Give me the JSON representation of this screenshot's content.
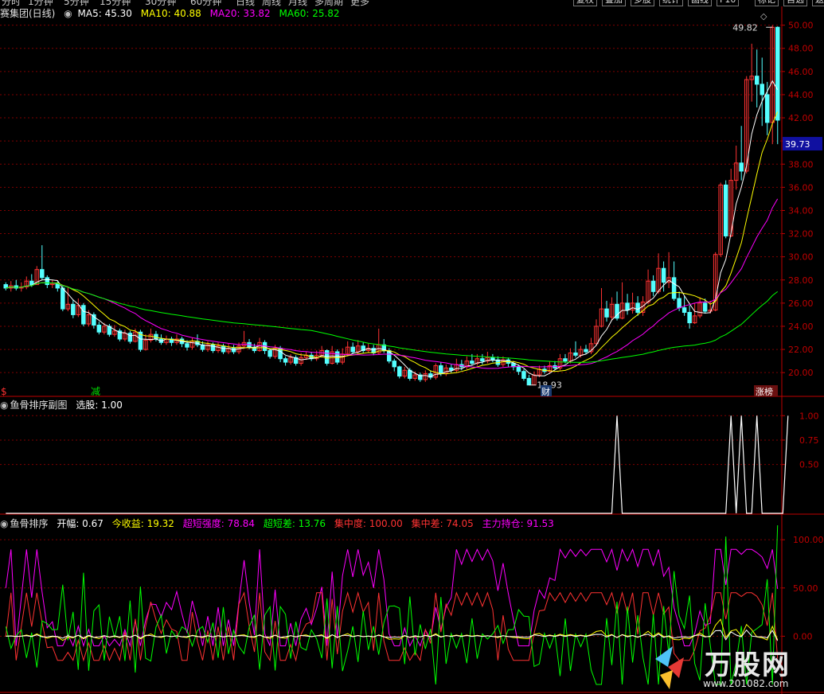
{
  "top_menu": {
    "left_items": [
      "分时",
      "1分钟",
      "5分钟",
      "15分钟",
      "30分钟",
      "60分钟",
      "日线",
      "周线",
      "月线",
      "多周期",
      "更多"
    ],
    "right_buttons": [
      "复权",
      "叠加",
      "多股",
      "统计",
      "画线",
      "F10",
      "标记",
      "自选",
      "返回"
    ]
  },
  "main_header": {
    "stock_name": "赛集团(日线)",
    "ma5": "MA5: 45.30",
    "ma10": "MA10: 40.88",
    "ma20": "MA20: 33.82",
    "ma60": "MA60: 25.82"
  },
  "sub1_header": {
    "title": "鱼骨排序副图",
    "value": "选股: 1.00"
  },
  "sub2_header": {
    "title": "鱼骨排序",
    "items": [
      "开幅: 0.67",
      "今收益: 19.32",
      "超短强度: 78.84",
      "超短差: 13.76",
      "集中度: 100.00",
      "集中差: 74.05",
      "主力持仓: 91.53"
    ]
  },
  "markers": {
    "left": "$",
    "reduce": "减",
    "fin": "财",
    "rank": "涨榜",
    "low": "18.93",
    "high": "49.82",
    "current": "39.73"
  },
  "watermark": {
    "big": "万股网",
    "url": "www.201082.com"
  },
  "colors": {
    "up": "#ff3232",
    "down": "#54ffff",
    "ma5": "#ffffff",
    "ma10": "#ffff00",
    "ma20": "#ff00ff",
    "ma60": "#00ff00",
    "grid": "#800000",
    "axis": "#c00000"
  },
  "chart_data": [
    {
      "type": "candlestick",
      "title": "赛集团(日线)",
      "y_ticks": [
        20.0,
        22.0,
        24.0,
        26.0,
        28.0,
        30.0,
        32.0,
        34.0,
        36.0,
        38.0,
        40.0,
        42.0,
        44.0,
        46.0,
        48.0,
        50.0
      ],
      "ylim": [
        18.5,
        50.8
      ],
      "ma_legend": [
        "MA5",
        "MA10",
        "MA20",
        "MA60"
      ],
      "candles": [
        [
          27.6,
          27.3,
          27.8,
          27.1
        ],
        [
          27.3,
          27.5,
          27.9,
          27.0
        ],
        [
          27.5,
          27.3,
          28.0,
          27.1
        ],
        [
          27.3,
          27.4,
          27.8,
          27.0
        ],
        [
          27.4,
          27.9,
          28.3,
          27.2
        ],
        [
          27.9,
          27.6,
          28.5,
          27.4
        ],
        [
          27.6,
          28.9,
          29.2,
          27.6
        ],
        [
          28.9,
          28.2,
          31.0,
          28.0
        ],
        [
          28.2,
          27.6,
          28.4,
          27.3
        ],
        [
          27.6,
          27.7,
          28.0,
          27.3
        ],
        [
          27.7,
          27.3,
          27.9,
          27.0
        ],
        [
          27.3,
          25.5,
          27.5,
          25.3
        ],
        [
          25.5,
          25.9,
          27.4,
          25.3
        ],
        [
          25.9,
          25.0,
          26.3,
          24.7
        ],
        [
          25.0,
          25.8,
          26.4,
          24.8
        ],
        [
          25.8,
          24.2,
          26.0,
          24.0
        ],
        [
          24.2,
          25.0,
          25.4,
          24.0
        ],
        [
          25.0,
          24.1,
          25.2,
          23.8
        ],
        [
          24.1,
          23.5,
          24.4,
          23.3
        ],
        [
          23.5,
          24.0,
          24.3,
          23.3
        ],
        [
          24.0,
          23.3,
          24.2,
          23.1
        ],
        [
          23.3,
          23.6,
          24.1,
          23.1
        ],
        [
          23.6,
          22.9,
          23.8,
          22.7
        ],
        [
          22.9,
          23.4,
          23.7,
          22.7
        ],
        [
          23.4,
          22.7,
          23.6,
          22.5
        ],
        [
          22.7,
          23.5,
          23.8,
          22.6
        ],
        [
          23.5,
          22.0,
          23.7,
          21.8
        ],
        [
          22.0,
          22.8,
          23.3,
          21.9
        ],
        [
          22.8,
          23.3,
          23.8,
          22.6
        ],
        [
          23.3,
          22.9,
          23.6,
          22.7
        ],
        [
          22.9,
          22.6,
          23.3,
          22.4
        ],
        [
          22.6,
          22.9,
          23.2,
          22.4
        ],
        [
          22.9,
          22.6,
          23.1,
          22.3
        ],
        [
          22.6,
          22.9,
          23.3,
          22.4
        ],
        [
          22.9,
          22.5,
          23.1,
          22.2
        ],
        [
          22.5,
          22.2,
          22.8,
          21.9
        ],
        [
          22.2,
          22.7,
          23.0,
          22.0
        ],
        [
          22.7,
          22.4,
          23.3,
          22.2
        ],
        [
          22.4,
          22.0,
          22.7,
          21.8
        ],
        [
          22.0,
          22.4,
          22.7,
          21.8
        ],
        [
          22.4,
          21.9,
          22.6,
          21.7
        ],
        [
          21.9,
          22.3,
          22.6,
          21.7
        ],
        [
          22.3,
          21.8,
          22.5,
          21.6
        ],
        [
          21.8,
          22.1,
          22.5,
          21.6
        ],
        [
          22.1,
          21.8,
          22.4,
          21.6
        ],
        [
          21.8,
          22.3,
          22.6,
          21.6
        ],
        [
          22.3,
          22.6,
          23.6,
          22.1
        ],
        [
          22.6,
          22.2,
          22.9,
          22.0
        ],
        [
          22.2,
          21.9,
          22.5,
          21.7
        ],
        [
          21.9,
          22.6,
          23.0,
          21.8
        ],
        [
          22.6,
          21.9,
          22.8,
          21.6
        ],
        [
          21.9,
          21.4,
          22.1,
          21.2
        ],
        [
          21.4,
          22.1,
          22.4,
          21.2
        ],
        [
          22.1,
          21.2,
          22.3,
          20.9
        ],
        [
          21.2,
          20.9,
          21.4,
          20.6
        ],
        [
          20.9,
          21.3,
          21.6,
          20.7
        ],
        [
          21.3,
          20.8,
          21.5,
          20.6
        ],
        [
          20.8,
          21.3,
          21.7,
          20.6
        ],
        [
          21.3,
          21.5,
          21.8,
          21.1
        ],
        [
          21.5,
          21.2,
          21.8,
          21.0
        ],
        [
          21.2,
          21.5,
          21.9,
          21.0
        ],
        [
          21.5,
          21.9,
          22.3,
          21.3
        ],
        [
          21.9,
          20.8,
          22.0,
          20.6
        ],
        [
          20.8,
          21.8,
          22.3,
          20.7
        ],
        [
          21.8,
          20.9,
          22.0,
          20.7
        ],
        [
          20.9,
          21.6,
          22.1,
          20.7
        ],
        [
          21.6,
          22.2,
          22.7,
          21.4
        ],
        [
          22.2,
          21.8,
          22.6,
          21.6
        ],
        [
          21.8,
          22.3,
          22.8,
          21.6
        ],
        [
          22.3,
          21.9,
          22.6,
          21.7
        ],
        [
          21.9,
          22.1,
          22.5,
          21.7
        ],
        [
          22.1,
          21.7,
          22.4,
          21.5
        ],
        [
          21.7,
          22.4,
          23.8,
          21.6
        ],
        [
          22.4,
          21.9,
          22.9,
          21.7
        ],
        [
          21.9,
          21.0,
          22.1,
          20.8
        ],
        [
          21.0,
          20.5,
          21.2,
          20.1
        ],
        [
          20.5,
          19.7,
          20.6,
          19.5
        ],
        [
          19.7,
          20.2,
          20.5,
          19.5
        ],
        [
          20.2,
          19.5,
          20.4,
          19.3
        ],
        [
          19.5,
          19.8,
          20.1,
          19.3
        ],
        [
          19.8,
          19.4,
          20.0,
          19.2
        ],
        [
          19.4,
          19.9,
          20.2,
          19.2
        ],
        [
          19.9,
          19.6,
          20.2,
          19.4
        ],
        [
          19.6,
          20.6,
          20.8,
          19.4
        ],
        [
          20.6,
          19.9,
          20.9,
          19.7
        ],
        [
          19.9,
          20.4,
          20.7,
          19.7
        ],
        [
          20.4,
          20.2,
          20.7,
          20.0
        ],
        [
          20.2,
          20.7,
          21.2,
          20.0
        ],
        [
          20.7,
          20.5,
          21.1,
          20.2
        ],
        [
          20.5,
          21.0,
          21.4,
          20.3
        ],
        [
          21.0,
          20.8,
          21.6,
          20.6
        ],
        [
          20.8,
          21.2,
          21.6,
          20.6
        ],
        [
          21.2,
          21.0,
          21.6,
          20.7
        ],
        [
          21.0,
          21.3,
          21.8,
          20.8
        ],
        [
          21.3,
          21.1,
          21.6,
          20.9
        ],
        [
          21.1,
          20.7,
          21.4,
          20.5
        ],
        [
          20.7,
          21.1,
          21.4,
          20.5
        ],
        [
          21.1,
          20.8,
          21.3,
          20.5
        ],
        [
          20.8,
          20.5,
          21.0,
          20.2
        ],
        [
          20.5,
          20.1,
          20.7,
          19.8
        ],
        [
          20.1,
          19.5,
          20.3,
          19.3
        ],
        [
          19.5,
          18.93,
          19.8,
          18.93
        ],
        [
          18.93,
          19.8,
          20.1,
          18.93
        ],
        [
          19.8,
          20.3,
          20.6,
          19.6
        ],
        [
          20.3,
          20.1,
          20.6,
          19.9
        ],
        [
          20.1,
          20.6,
          21.0,
          19.9
        ],
        [
          20.6,
          20.4,
          21.0,
          20.2
        ],
        [
          20.4,
          21.2,
          21.6,
          20.2
        ],
        [
          21.2,
          21.0,
          21.6,
          20.8
        ],
        [
          21.0,
          21.7,
          22.1,
          20.8
        ],
        [
          21.7,
          21.5,
          22.7,
          21.3
        ],
        [
          21.5,
          22.0,
          22.3,
          21.3
        ],
        [
          22.0,
          21.8,
          22.4,
          21.6
        ],
        [
          21.8,
          22.5,
          23.0,
          21.6
        ],
        [
          22.5,
          24.0,
          24.6,
          22.3
        ],
        [
          24.0,
          25.5,
          27.3,
          23.9
        ],
        [
          25.5,
          24.8,
          26.2,
          24.4
        ],
        [
          24.8,
          25.9,
          26.5,
          24.5
        ],
        [
          25.9,
          24.7,
          27.0,
          24.5
        ],
        [
          24.7,
          26.0,
          27.8,
          24.6
        ],
        [
          26.0,
          25.4,
          26.8,
          25.0
        ],
        [
          25.4,
          26.0,
          26.9,
          25.1
        ],
        [
          26.0,
          25.2,
          26.6,
          24.9
        ],
        [
          25.2,
          26.1,
          26.6,
          24.9
        ],
        [
          26.1,
          27.9,
          28.9,
          25.9
        ],
        [
          27.9,
          27.0,
          28.4,
          26.6
        ],
        [
          27.0,
          29.0,
          30.3,
          26.8
        ],
        [
          29.0,
          27.8,
          29.6,
          27.0
        ],
        [
          27.8,
          28.2,
          30.4,
          27.3
        ],
        [
          28.2,
          26.4,
          29.6,
          26.2
        ],
        [
          26.4,
          25.6,
          27.0,
          25.3
        ],
        [
          25.6,
          25.2,
          26.6,
          24.9
        ],
        [
          25.2,
          24.3,
          25.8,
          23.8
        ],
        [
          24.3,
          24.9,
          26.0,
          24.2
        ],
        [
          24.9,
          26.0,
          26.5,
          24.7
        ],
        [
          26.0,
          25.3,
          26.4,
          25.1
        ],
        [
          25.3,
          25.4,
          26.2,
          25.1
        ],
        [
          25.4,
          30.2,
          30.4,
          25.3
        ],
        [
          30.2,
          36.2,
          36.4,
          30.0
        ],
        [
          36.2,
          31.8,
          36.6,
          31.6
        ],
        [
          31.8,
          36.6,
          37.6,
          31.7
        ],
        [
          36.6,
          38.1,
          39.6,
          35.8
        ],
        [
          38.1,
          37.4,
          41.3,
          36.6
        ],
        [
          37.4,
          45.3,
          45.6,
          37.2
        ],
        [
          45.3,
          45.6,
          48.4,
          43.4
        ],
        [
          45.6,
          44.9,
          47.9,
          42.9
        ],
        [
          44.9,
          44.0,
          47.2,
          41.3
        ],
        [
          44.0,
          41.6,
          45.1,
          40.5
        ],
        [
          41.6,
          49.82,
          50.0,
          39.73
        ],
        [
          49.82,
          41.8,
          49.9,
          39.73
        ]
      ],
      "ma_period": [
        5,
        10,
        20,
        60
      ]
    },
    {
      "type": "line",
      "title": "鱼骨排序副图",
      "y_ticks": [
        0.5,
        0.75,
        1.0
      ],
      "ylim": [
        0.0,
        1.1
      ],
      "series": [
        {
          "name": "选股",
          "values": [
            0,
            0,
            0,
            0,
            0,
            0,
            0,
            0,
            0,
            0,
            0,
            0,
            0,
            0,
            0,
            0,
            0,
            0,
            0,
            0,
            0,
            0,
            0,
            0,
            0,
            0,
            0,
            0,
            0,
            0,
            0,
            0,
            0,
            0,
            0,
            0,
            0,
            0,
            0,
            0,
            0,
            0,
            0,
            0,
            0,
            0,
            0,
            0,
            0,
            0,
            0,
            0,
            0,
            0,
            0,
            0,
            0,
            0,
            0,
            0,
            0,
            0,
            0,
            0,
            0,
            0,
            0,
            0,
            0,
            0,
            0,
            0,
            0,
            0,
            0,
            0,
            0,
            0,
            0,
            0,
            0,
            0,
            0,
            0,
            0,
            0,
            0,
            0,
            0,
            0,
            0,
            0,
            0,
            0,
            0,
            0,
            0,
            0,
            0,
            0,
            0,
            0,
            0,
            0,
            0,
            0,
            0,
            0,
            0,
            0,
            0,
            0,
            0,
            0,
            0,
            0,
            0,
            0,
            1,
            0,
            0,
            0,
            0,
            0,
            0,
            0,
            0,
            0,
            0,
            0,
            0,
            0,
            0,
            0,
            0,
            0,
            0,
            0,
            0,
            0,
            1,
            0,
            1,
            0,
            0,
            1,
            0,
            0,
            0,
            0,
            0,
            1
          ]
        }
      ]
    },
    {
      "type": "line",
      "title": "鱼骨排序",
      "y_ticks": [
        0.0,
        50.0,
        100.0
      ],
      "ylim": [
        -50,
        115
      ],
      "legend": [
        "开幅",
        "今收益",
        "超短强度",
        "超短差",
        "集中度",
        "集中差",
        "主力持仓"
      ],
      "latest": [
        0.67,
        19.32,
        78.84,
        13.76,
        100.0,
        74.05,
        91.53
      ]
    }
  ]
}
